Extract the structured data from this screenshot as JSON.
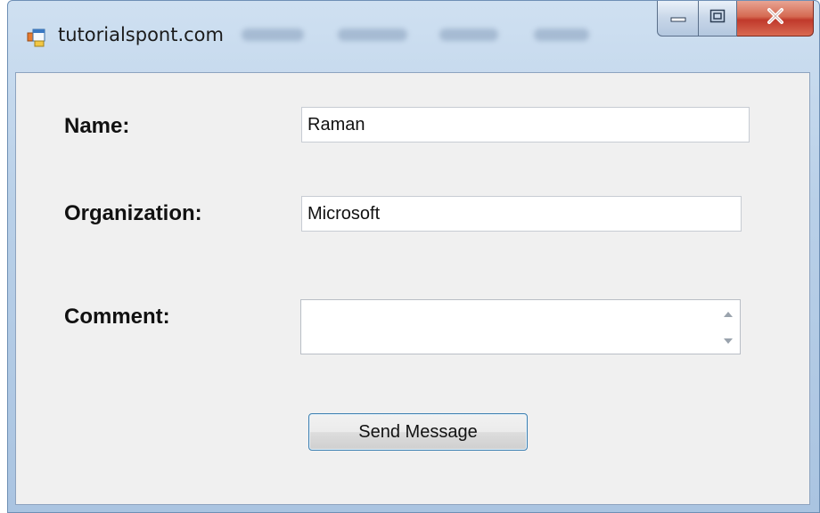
{
  "window": {
    "title": "tutorialspont.com",
    "icon": "form-app-icon"
  },
  "window_controls": {
    "minimize": "minimize-icon",
    "maximize": "maximize-icon",
    "close": "close-icon"
  },
  "form": {
    "name_label": "Name:",
    "name_value": "Raman",
    "organization_label": "Organization:",
    "organization_value": "Microsoft",
    "comment_label": "Comment:",
    "comment_value": "",
    "send_button": "Send Message"
  },
  "colors": {
    "client_bg": "#f0f0f0",
    "close_button": "#c0392b",
    "button_border": "#3c7fb1"
  }
}
